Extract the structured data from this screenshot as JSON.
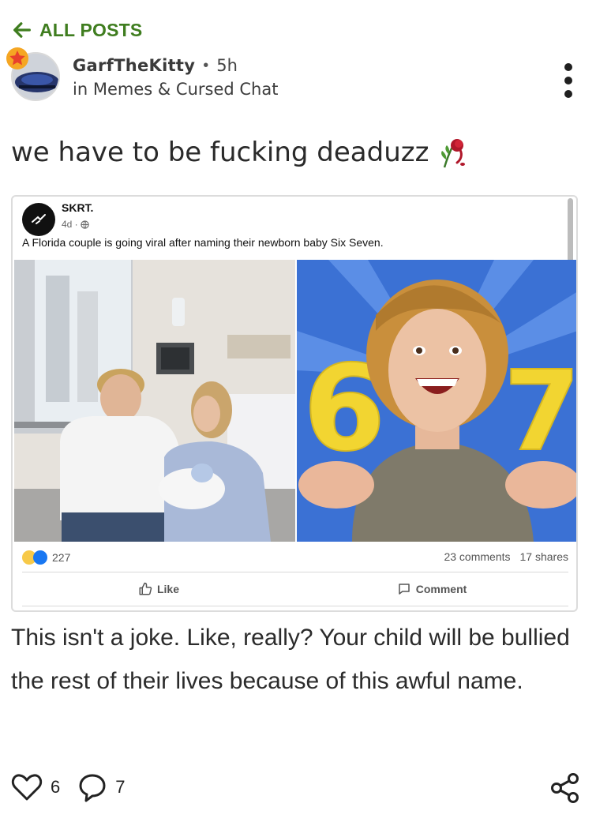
{
  "nav": {
    "back_label": "ALL POSTS"
  },
  "post": {
    "author": "GarfTheKitty",
    "time": "5h",
    "community": "in Memes & Cursed Chat",
    "title": "we have to be fucking deaduzz",
    "body": "This isn't a joke. Like, really? Your child will be bullied the rest of their lives because of this awful name.",
    "likes": "6",
    "comments": "7"
  },
  "embed": {
    "page_name": "SKRT.",
    "time": "4d ·",
    "caption": "A Florida couple is going viral after naming their newborn baby Six Seven.",
    "reaction_count": "227",
    "comments": "23 comments",
    "shares": "17 shares",
    "like_label": "Like",
    "comment_label": "Comment",
    "digit_six": "6",
    "digit_seven": "7"
  },
  "colors": {
    "accent": "#3f7d1f",
    "badge": "#f5a623"
  }
}
